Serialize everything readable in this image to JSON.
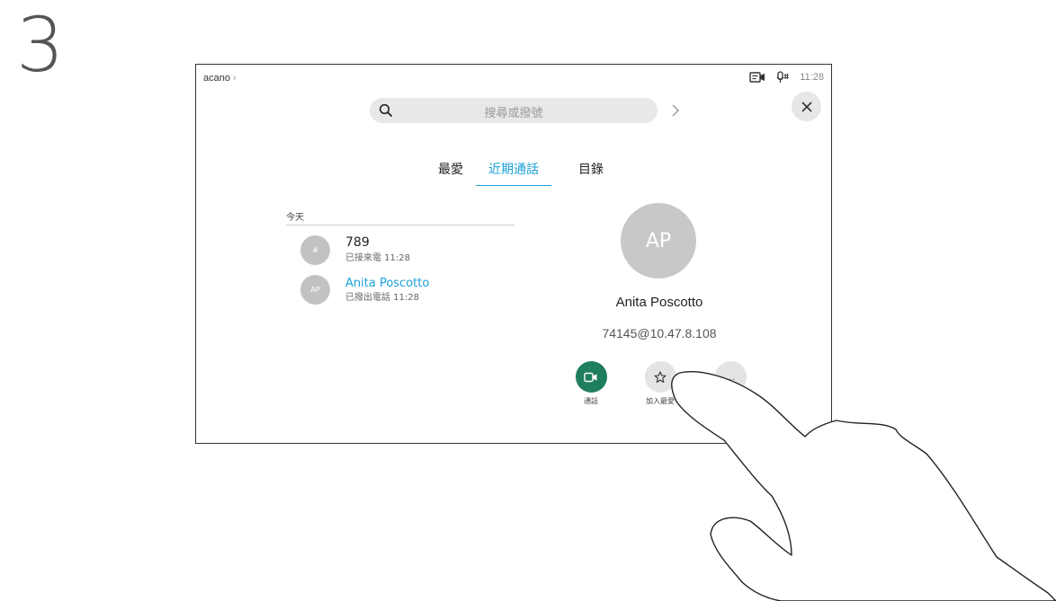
{
  "step_number": "3",
  "header": {
    "breadcrumb": "acano",
    "breadcrumb_chevron": "›",
    "time": "11:28"
  },
  "search": {
    "placeholder": "搜尋或撥號"
  },
  "tabs": [
    {
      "label": "最愛",
      "selected": false
    },
    {
      "label": "近期通話",
      "selected": true
    },
    {
      "label": "目錄",
      "selected": false
    }
  ],
  "recents": {
    "section_header": "今天",
    "items": [
      {
        "avatar": "#",
        "name": "789",
        "detail": "已接來電 11:28"
      },
      {
        "avatar": "AP",
        "name": "Anita Poscotto",
        "detail": "已撥出電話 11:28"
      }
    ]
  },
  "contact": {
    "initials": "AP",
    "name": "Anita Poscotto",
    "address": "74145@10.47.8.108"
  },
  "actions": {
    "call_label": "通話",
    "favorite_label": "加入最愛",
    "more_label": "…"
  },
  "colors": {
    "accent": "#1ba0d8",
    "call_green": "#1f7f5c",
    "avatar_gray": "#c8c8c8"
  },
  "icons": [
    "camera-status-icon",
    "microphone-status-icon",
    "search-icon",
    "chevron-right-icon",
    "close-icon",
    "video-call-icon",
    "star-icon",
    "more-icon"
  ]
}
